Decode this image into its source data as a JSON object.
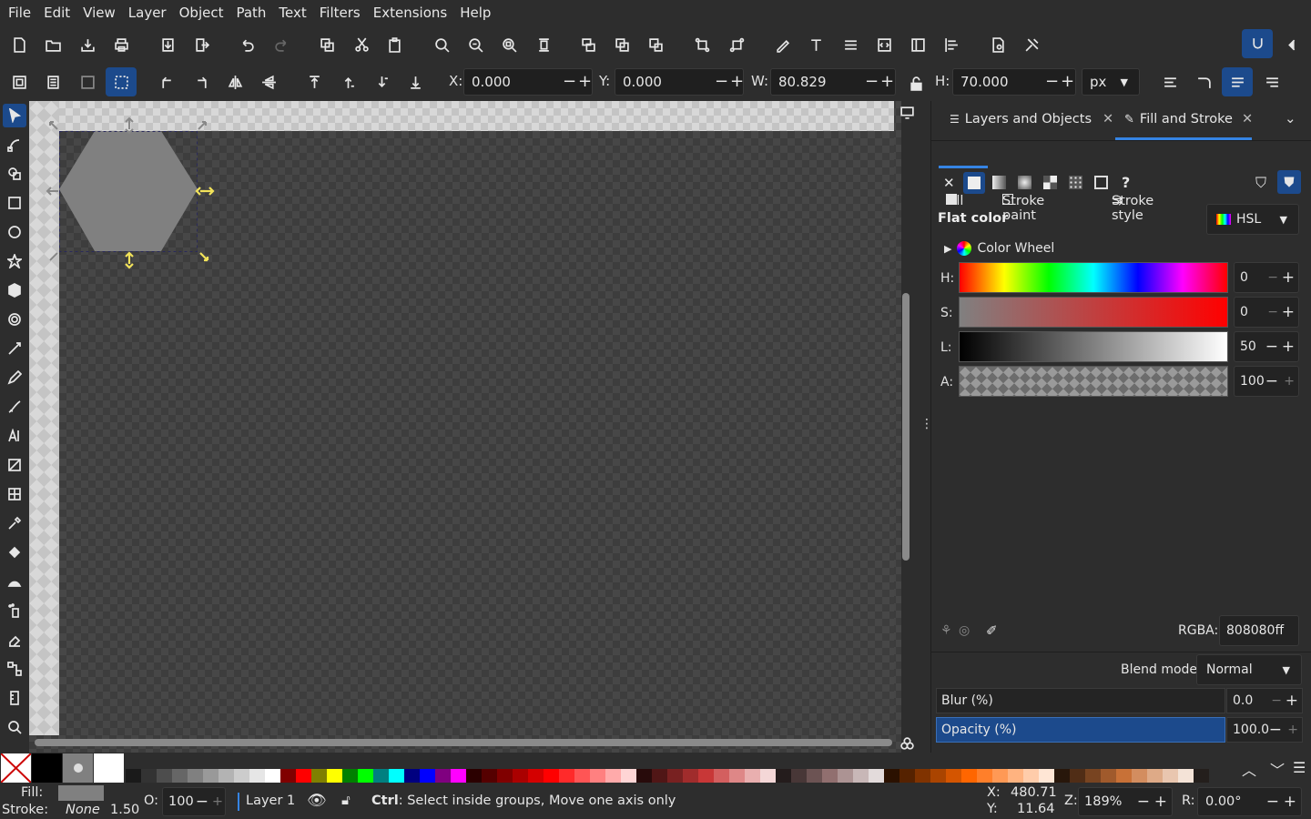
{
  "menu": [
    "File",
    "Edit",
    "View",
    "Layer",
    "Object",
    "Path",
    "Text",
    "Filters",
    "Extensions",
    "Help"
  ],
  "toolctrl": {
    "x_label": "X:",
    "x": "0.000",
    "y_label": "Y:",
    "y": "0.000",
    "w_label": "W:",
    "w": "80.829",
    "h_label": "H:",
    "h": "70.000",
    "unit": "px"
  },
  "dock": {
    "tab1": "Layers and Objects",
    "tab2": "Fill and Stroke",
    "fill": "Fill",
    "stroke_paint": "Stroke paint",
    "stroke_style": "Stroke style",
    "flat_color": "Flat color",
    "mode": "HSL",
    "color_wheel": "Color Wheel",
    "h_label": "H:",
    "h": "0",
    "s_label": "S:",
    "s": "0",
    "l_label": "L:",
    "l": "50",
    "a_label": "A:",
    "a": "100",
    "rgba_label": "RGBA:",
    "rgba": "808080ff",
    "blend_label": "Blend mode:",
    "blend": "Normal",
    "blur_label": "Blur (%)",
    "blur": "0.0",
    "opacity_label": "Opacity (%)",
    "opacity": "100.0"
  },
  "status": {
    "fill_label": "Fill:",
    "stroke_label": "Stroke:",
    "stroke_value": "None",
    "stroke_width": "1.50",
    "o_label": "O:",
    "o": "100",
    "layer": "Layer 1",
    "message_bold": "Ctrl",
    "message": ": Select inside groups, Move one axis only",
    "cx_label": "X:",
    "cx": "480.71",
    "cy_label": "Y:",
    "cy": "11.64",
    "z_label": "Z:",
    "zoom": "189%",
    "r_label": "R:",
    "rotation": "0.00°"
  },
  "colors": {
    "accent": "#1c4a8c",
    "object_fill": "#808080"
  },
  "palette_colors": [
    "#1a1a1a",
    "#333333",
    "#4d4d4d",
    "#666666",
    "#808080",
    "#999999",
    "#b3b3b3",
    "#cccccc",
    "#e6e6e6",
    "#ffffff",
    "#800000",
    "#ff0000",
    "#808000",
    "#ffff00",
    "#008000",
    "#00ff00",
    "#008080",
    "#00ffff",
    "#000080",
    "#0000ff",
    "#800080",
    "#ff00ff",
    "#2b0000",
    "#550000",
    "#800000",
    "#aa0000",
    "#d40000",
    "#ff0000",
    "#ff2a2a",
    "#ff5555",
    "#ff8080",
    "#ffaaaa",
    "#ffd5d5",
    "#280b0b",
    "#501616",
    "#782121",
    "#a02c2c",
    "#c83737",
    "#d35f5f",
    "#de8787",
    "#e9afaf",
    "#f4d7d7",
    "#241c1c",
    "#483737",
    "#6c5353",
    "#916f6f",
    "#ac9393",
    "#c8b7b7",
    "#e3dbdb",
    "#2b1100",
    "#552200",
    "#803300",
    "#aa4400",
    "#d45500",
    "#ff6600",
    "#ff7f2a",
    "#ff9955",
    "#ffb380",
    "#ffccaa",
    "#ffe6d5",
    "#28170b",
    "#502d16",
    "#784421",
    "#a05a2c",
    "#c87137",
    "#d38d5f",
    "#deaa87",
    "#e9c6af",
    "#f4e3d7",
    "#241f1c"
  ]
}
